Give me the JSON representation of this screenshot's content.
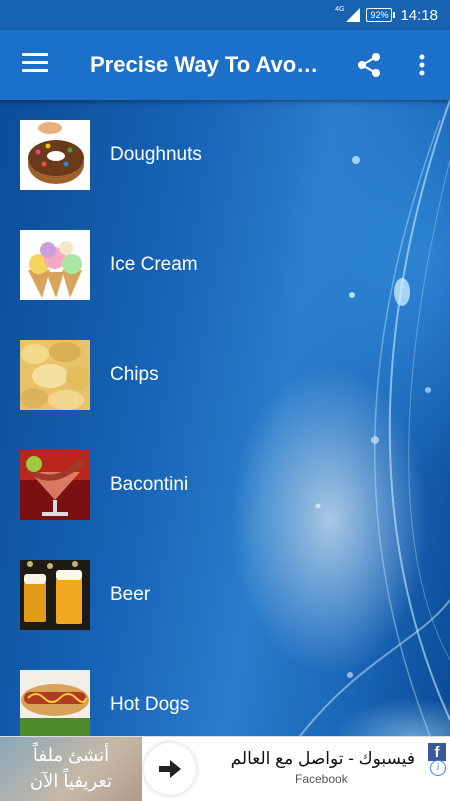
{
  "status_bar": {
    "network": "4G",
    "battery": "92%",
    "time": "14:18"
  },
  "app_bar": {
    "title": "Precise Way To Avo…",
    "menu_icon": "hamburger-menu-icon",
    "share_icon": "share-icon",
    "more_icon": "more-vertical-icon"
  },
  "list": {
    "items": [
      {
        "label": "Doughnuts"
      },
      {
        "label": "Ice Cream"
      },
      {
        "label": "Chips"
      },
      {
        "label": "Bacontini"
      },
      {
        "label": "Beer"
      },
      {
        "label": "Hot Dogs"
      }
    ]
  },
  "ad": {
    "left_text_line1": "أنشئ ملفاً",
    "left_text_line2": "تعريفياً الآن",
    "headline": "فيسبوك - تواصل مع العالم",
    "sub": "Facebook",
    "fb_logo": "f",
    "info_icon": "i"
  },
  "colors": {
    "status_bar": "#1762b1",
    "app_bar": "#1d70c9",
    "background": "#0d4f9c"
  }
}
